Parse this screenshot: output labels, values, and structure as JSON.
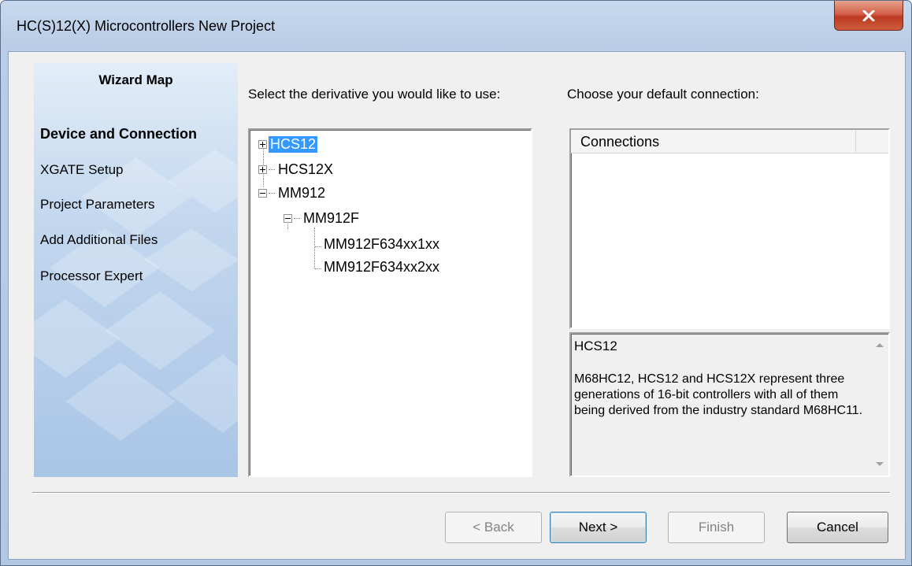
{
  "window": {
    "title": "HC(S)12(X) Microcontrollers New Project",
    "close_icon": "close-x-icon"
  },
  "wizard_map": {
    "title": "Wizard Map",
    "items": [
      {
        "label": "Device and Connection",
        "active": true
      },
      {
        "label": "XGATE Setup",
        "active": false
      },
      {
        "label": "Project Parameters",
        "active": false
      },
      {
        "label": "Add Additional Files",
        "active": false
      },
      {
        "label": "Processor Expert",
        "active": false
      }
    ]
  },
  "derivative": {
    "label": "Select the derivative you would like to use:",
    "tree": [
      {
        "label": "HCS12",
        "expander": "plus",
        "selected": true
      },
      {
        "label": "HCS12X",
        "expander": "plus",
        "selected": false
      },
      {
        "label": "MM912",
        "expander": "minus",
        "selected": false
      },
      {
        "label": "MM912F",
        "expander": "minus",
        "selected": false
      },
      {
        "label": "MM912F634xx1xx",
        "expander": "none",
        "selected": false
      },
      {
        "label": "MM912F634xx2xx",
        "expander": "none",
        "selected": false
      }
    ]
  },
  "connection": {
    "label": "Choose your default connection:",
    "header": "Connections"
  },
  "description": {
    "title": "HCS12",
    "body": "M68HC12, HCS12 and HCS12X represent three generations of 16-bit controllers with all of them being derived from the industry standard M68HC11."
  },
  "buttons": {
    "back": "< Back",
    "next": "Next >",
    "finish": "Finish",
    "cancel": "Cancel"
  },
  "colors": {
    "selection": "#3399ff",
    "close_button": "#c7503a"
  }
}
